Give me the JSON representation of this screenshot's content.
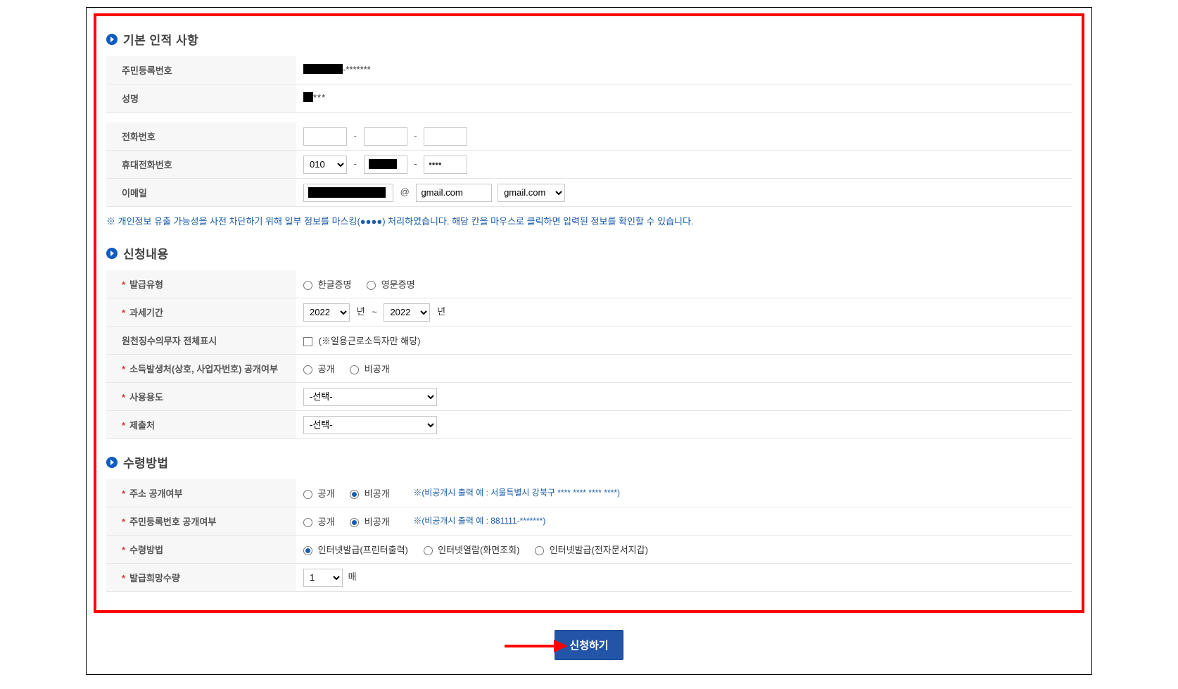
{
  "sections": {
    "basic": {
      "title": "기본 인적 사항"
    },
    "content": {
      "title": "신청내용"
    },
    "receipt": {
      "title": "수령방법"
    }
  },
  "basic": {
    "rrn_label": "주민등록번호",
    "rrn_suffix": "-*******",
    "name_label": "성명",
    "name_suffix": "***",
    "phone_label": "전화번호",
    "mobile_label": "휴대전화번호",
    "mobile_prefix": "010",
    "mobile_last": "••••",
    "email_label": "이메일",
    "email_at": "@",
    "email_domain": "gmail.com",
    "email_domain_sel": "gmail.com"
  },
  "note": "※ 개인정보 유출 가능성을 사전 차단하기 위해 일부 정보를 마스킹(●●●●) 처리하였습니다. 해당 칸을 마우스로 클릭하면 입력된 정보를 확인할 수 있습니다.",
  "content": {
    "issue_type_label": "발급유형",
    "issue_ko": "한글증명",
    "issue_en": "영문증명",
    "tax_period_label": "과세기간",
    "tax_from": "2022",
    "year_unit": "년",
    "tilde": "~",
    "tax_to": "2022",
    "witholding_label": "원천징수의무자 전체표시",
    "witholding_note": "(※일용근로소득자만 해당)",
    "source_label": "소득발생처(상호, 사업자번호) 공개여부",
    "public": "공개",
    "private": "비공개",
    "purpose_label": "사용용도",
    "select_placeholder": "-선택-",
    "submitto_label": "제출처"
  },
  "receipt": {
    "addr_label": "주소 공개여부",
    "addr_help": "※(비공개시 출력 예 : 서울특별시 강북구 **** **** **** ****)",
    "rrn_label": "주민등록번호 공개여부",
    "rrn_help": "※(비공개시 출력 예 : 881111-*******)",
    "method_label": "수령방법",
    "method_opt1": "인터넷발급(프린터출력)",
    "method_opt2": "인터넷열람(화면조회)",
    "method_opt3": "인터넷발급(전자문서지갑)",
    "qty_label": "발급희망수량",
    "qty_val": "1",
    "qty_unit": "매"
  },
  "submit_label": "신청하기"
}
